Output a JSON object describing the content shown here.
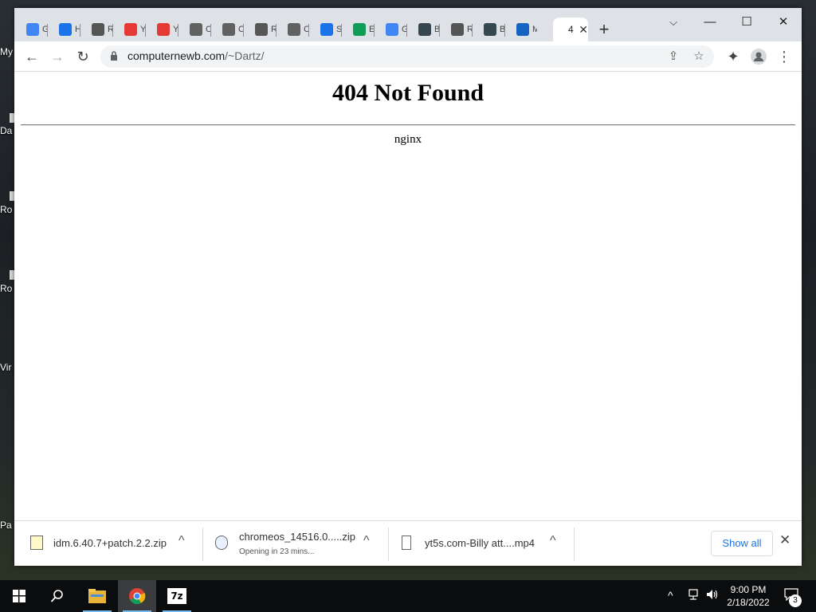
{
  "desktop": {
    "icons": [
      "My",
      "Da",
      "Ro",
      "Ro",
      "Vir",
      "Pa"
    ]
  },
  "tabs": [
    {
      "icon": "google-icon",
      "text": "G",
      "color": "#4285f4"
    },
    {
      "icon": "history-icon",
      "text": "H",
      "color": "#1a73e8"
    },
    {
      "icon": "roblox-icon",
      "text": "R",
      "color": "#555555"
    },
    {
      "icon": "red-app-icon",
      "text": "Y",
      "color": "#e53935"
    },
    {
      "icon": "red-app-icon",
      "text": "Y",
      "color": "#e53935"
    },
    {
      "icon": "chrome-icon",
      "text": "C",
      "color": "#616161"
    },
    {
      "icon": "chrome-icon",
      "text": "C",
      "color": "#616161"
    },
    {
      "icon": "roblox-icon",
      "text": "R",
      "color": "#555555"
    },
    {
      "icon": "chrome-icon",
      "text": "C",
      "color": "#616161"
    },
    {
      "icon": "settings-icon",
      "text": "S",
      "color": "#1a73e8"
    },
    {
      "icon": "edge-icon",
      "text": "E",
      "color": "#0f9d58"
    },
    {
      "icon": "google-icon",
      "text": "G",
      "color": "#4285f4"
    },
    {
      "icon": "bird-icon",
      "text": "B",
      "color": "#37474f"
    },
    {
      "icon": "roblox-icon",
      "text": "R",
      "color": "#555555"
    },
    {
      "icon": "bird-icon",
      "text": "B",
      "color": "#37474f"
    },
    {
      "icon": "chart-app-icon",
      "text": "M",
      "color": "#1565c0"
    }
  ],
  "active_tab": {
    "text": "4",
    "close": "✕"
  },
  "window_controls": {
    "dropdown": "⌵",
    "minimize": "—",
    "maximize": "☐",
    "close": "✕"
  },
  "toolbar": {
    "back": "←",
    "forward": "→",
    "reload": "↻",
    "url_host": "computernewb.com",
    "url_path": "/~Dartz/",
    "share": "⇪",
    "star": "☆",
    "extensions": "✦",
    "menu": "⋮"
  },
  "page": {
    "title": "404 Not Found",
    "server": "nginx"
  },
  "downloads": [
    {
      "name": "idm.6.40.7+patch.2.2.zip",
      "status": ""
    },
    {
      "name": "chromeos_14516.0.....zip",
      "status": "Opening in 23 mins..."
    },
    {
      "name": "yt5s.com-Billy att....mp4",
      "status": ""
    }
  ],
  "downloads_bar": {
    "show_all": "Show all",
    "close": "✕",
    "caret": "^"
  },
  "taskbar": {
    "time": "9:00 PM",
    "date": "2/18/2022",
    "notifications": "3",
    "sevenzip_label": "7z"
  },
  "colors": {
    "accent": "#1a73e8",
    "tabstrip": "#dee1e6"
  }
}
